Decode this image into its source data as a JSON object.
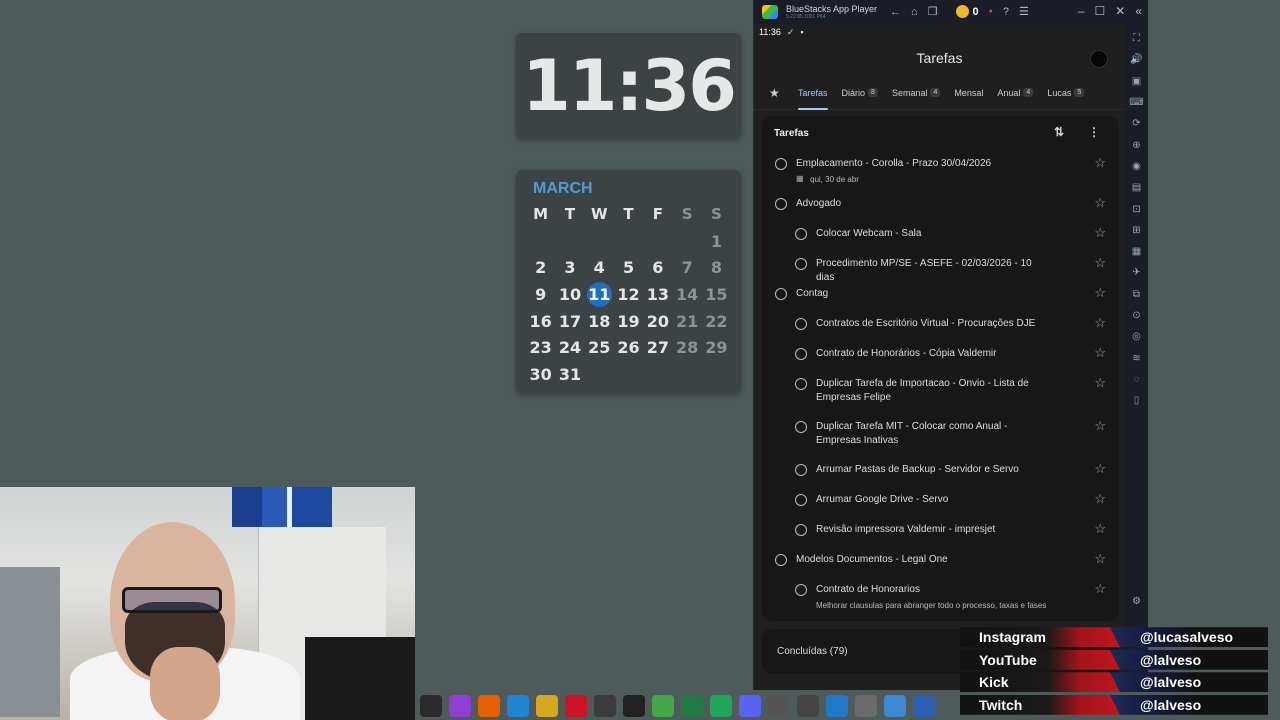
{
  "clock": {
    "time": "11:36"
  },
  "calendar": {
    "month": "MARCH",
    "weekdays": [
      "M",
      "T",
      "W",
      "T",
      "F",
      "S",
      "S"
    ],
    "weeks": [
      [
        "",
        "",
        "",
        "",
        "",
        "",
        "1"
      ],
      [
        "2",
        "3",
        "4",
        "5",
        "6",
        "7",
        "8"
      ],
      [
        "9",
        "10",
        "11",
        "12",
        "13",
        "14",
        "15"
      ],
      [
        "16",
        "17",
        "18",
        "19",
        "20",
        "21",
        "22"
      ],
      [
        "23",
        "24",
        "25",
        "26",
        "27",
        "28",
        "29"
      ],
      [
        "30",
        "31",
        "",
        "",
        "",
        "",
        ""
      ]
    ],
    "today": "11"
  },
  "bluestacks": {
    "title": "BlueStacks App Player",
    "subtitle": "5.22.85.1001 P64",
    "coins": "0",
    "status_time": "11:36"
  },
  "tasks_app": {
    "header": "Tarefas",
    "tabs": [
      {
        "label": "Tarefas",
        "count": ""
      },
      {
        "label": "Diário",
        "count": "8"
      },
      {
        "label": "Semanal",
        "count": "4"
      },
      {
        "label": "Mensal",
        "count": ""
      },
      {
        "label": "Anual",
        "count": "4"
      },
      {
        "label": "Lucas",
        "count": "5"
      }
    ],
    "list_title": "Tarefas",
    "tasks": [
      {
        "text": "Emplacamento - Corolla - Prazo 30/04/2026",
        "sub": "qui, 30 de abr",
        "level": 0
      },
      {
        "text": "Advogado",
        "sub": "",
        "level": 0
      },
      {
        "text": "Colocar Webcam - Sala",
        "sub": "",
        "level": 1
      },
      {
        "text": "Procedimento MP/SE - ASEFE - 02/03/2026 - 10 dias",
        "sub": "",
        "level": 1
      },
      {
        "text": "Contag",
        "sub": "",
        "level": 0
      },
      {
        "text": "Contratos de Escritório Virtual - Procurações DJE",
        "sub": "",
        "level": 1
      },
      {
        "text": "Contrato de Honorários - Cópia Valdemir",
        "sub": "",
        "level": 1
      },
      {
        "text": "Duplicar Tarefa de Importacao - Onvio - Lista de Empresas Felipe",
        "sub": "",
        "level": 1
      },
      {
        "text": "Duplicar Tarefa MIT - Colocar como Anual - Empresas Inativas",
        "sub": "",
        "level": 1
      },
      {
        "text": "Arrumar Pastas de Backup - Servidor e Servo",
        "sub": "",
        "level": 1
      },
      {
        "text": "Arrumar Google Drive - Servo",
        "sub": "",
        "level": 1
      },
      {
        "text": "Revisão impressora Valdemir - impresjet",
        "sub": "",
        "level": 1
      },
      {
        "text": "Modelos Documentos - Legal One",
        "sub": "",
        "level": 0
      },
      {
        "text": "Contrato de Honorarios",
        "sub": "Melhorar clausulas para abranger todo o processo, taxas e fases",
        "level": 1
      }
    ],
    "completed": "Concluídas (79)"
  },
  "social": [
    {
      "network": "Instagram",
      "handle": "@lucasalveso"
    },
    {
      "network": "YouTube",
      "handle": "@lalveso"
    },
    {
      "network": "Kick",
      "handle": "@lalveso"
    },
    {
      "network": "Twitch",
      "handle": "@lalveso"
    }
  ],
  "taskbar": [
    {
      "name": "app-icon",
      "color": "#2b2b2b"
    },
    {
      "name": "app-icon",
      "color": "#8e3fd1"
    },
    {
      "name": "firefox-icon",
      "color": "#e66000"
    },
    {
      "name": "edge-icon",
      "color": "#1f86d1"
    },
    {
      "name": "chrome-icon",
      "color": "#d6a821"
    },
    {
      "name": "opera-icon",
      "color": "#cc1424"
    },
    {
      "name": "app-icon",
      "color": "#3b3b3b"
    },
    {
      "name": "capcut-icon",
      "color": "#222222"
    },
    {
      "name": "bluestacks-icon",
      "color": "#44a84a"
    },
    {
      "name": "excel-icon",
      "color": "#1f7a43"
    },
    {
      "name": "sheets-icon",
      "color": "#23a55a"
    },
    {
      "name": "discord-icon",
      "color": "#5865f2"
    },
    {
      "name": "app-icon",
      "color": "#555555"
    },
    {
      "name": "app-icon",
      "color": "#444444"
    },
    {
      "name": "vscode-icon",
      "color": "#1e7ac8"
    },
    {
      "name": "app-icon",
      "color": "#6b6b6b"
    },
    {
      "name": "notepad-icon",
      "color": "#3c8bd2"
    },
    {
      "name": "word-icon",
      "color": "#2b5fb4"
    }
  ]
}
